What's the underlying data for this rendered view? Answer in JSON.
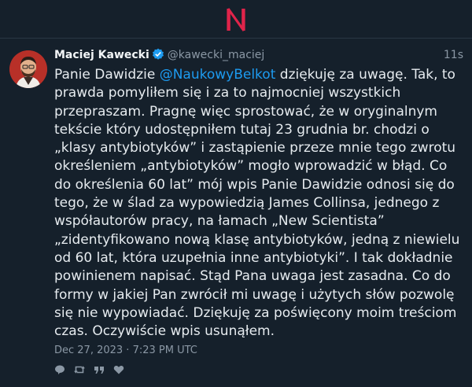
{
  "app": {
    "logo_icon": "nitter-n-logo",
    "accent": "#e0244a"
  },
  "tweet": {
    "author_name": "Maciej Kawecki",
    "handle": "@kawecki_maciej",
    "relative_time": "11s",
    "text_before": "Panie Dawidzie ",
    "mention": "@NaukowyBelkot",
    "text_after": " dziękuję za uwagę. Tak, to prawda pomyliłem się i za to najmocniej wszystkich przepraszam. Pragnę więc sprostować, że w oryginalnym tekście który udostępniłem tutaj 23 grudnia br. chodzi o „klasy antybiotyków” i zastąpienie przeze mnie tego zwrotu określeniem „antybiotyków” mogło wprowadzić w błąd. Co do określenia 60 lat” mój wpis Panie Dawidzie odnosi się do tego, że w ślad za wypowiedzią James Collinsa, jednego z współautorów pracy, na łamach „New Scientista” „zidentyfikowano nową klasę antybiotyków, jedną z niewielu od 60 lat, która uzupełnia inne antybiotyki”. I tak dokładnie powinienem napisać. Stąd Pana uwaga jest zasadna. Co do formy w jakiej Pan zwrócił mi uwagę i użytych słów pozwolę się nie wypowiadać. Dziękuję za poświęcony moim treściom czas. Oczywiście wpis usunąłem.",
    "date": "Dec 27, 2023 · 7:23 PM UTC",
    "verified_icon": "verified-badge-icon",
    "mention_color": "#1d9bf0",
    "actions": [
      "reply-icon",
      "retweet-icon",
      "quote-icon",
      "like-icon"
    ]
  }
}
